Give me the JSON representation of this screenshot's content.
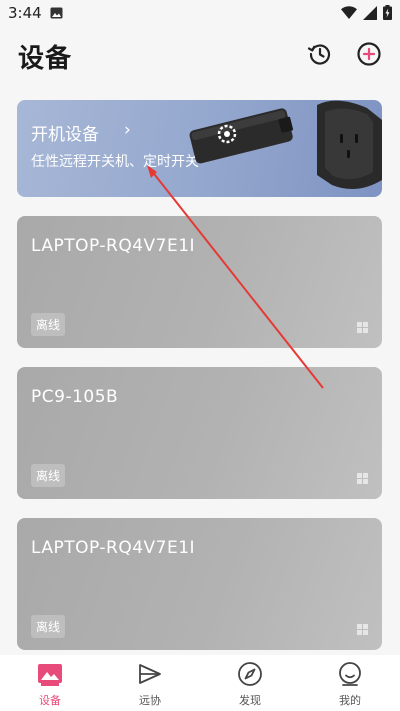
{
  "status_bar": {
    "time": "3:44",
    "icons": [
      "photo-icon",
      "wifi-icon",
      "signal-icon",
      "battery-charging-icon"
    ]
  },
  "header": {
    "title": "设备",
    "actions": [
      {
        "icon": "history-icon"
      },
      {
        "icon": "add-circle-icon"
      }
    ]
  },
  "promo": {
    "title": "开机设备",
    "chevron": "›",
    "subtitle": "任性远程开关机、定时开关"
  },
  "devices": [
    {
      "name": "LAPTOP-RQ4V7E1I",
      "status": "离线",
      "os_icon": "windows-icon"
    },
    {
      "name": "PC9-105B",
      "status": "离线",
      "os_icon": "windows-icon"
    },
    {
      "name": "LAPTOP-RQ4V7E1I",
      "status": "离线",
      "os_icon": "windows-icon"
    }
  ],
  "bottom_nav": {
    "items": [
      {
        "label": "设备",
        "icon": "devices-icon",
        "active": true
      },
      {
        "label": "远协",
        "icon": "remote-assist-icon",
        "active": false
      },
      {
        "label": "发现",
        "icon": "compass-icon",
        "active": false
      },
      {
        "label": "我的",
        "icon": "profile-icon",
        "active": false
      }
    ]
  },
  "colors": {
    "accent": "#e84a7a",
    "promo_bg": "#93a6cd",
    "card_bg": "#b2b2b2",
    "annotation_arrow": "#e53935"
  }
}
